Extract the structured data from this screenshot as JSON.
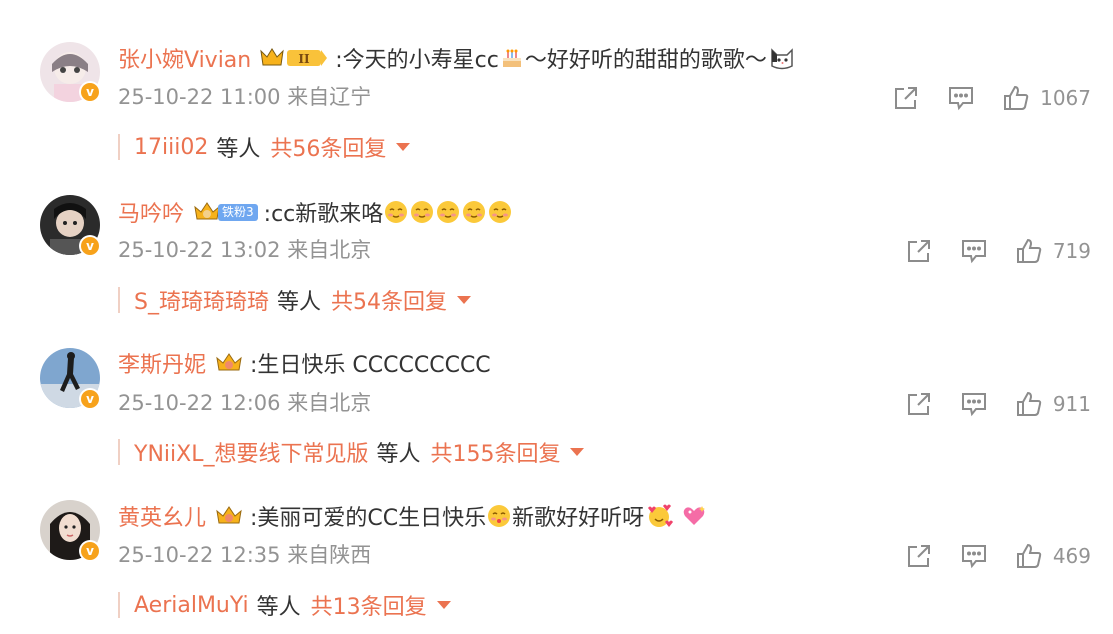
{
  "colors": {
    "accent": "#eb7350",
    "meta": "#939393",
    "text": "#333333",
    "vip": "#f7a21b"
  },
  "comments": [
    {
      "user": "张小婉Vivian",
      "badge_tag": "",
      "text_before": ":今天的小寿星cc",
      "text_after": "～好好听的甜甜的歌歌～",
      "time": "25-10-22 11:00",
      "location": "来自辽宁",
      "likes": "1067",
      "reply_user": "17iii02",
      "reply_mid": "等人",
      "reply_total": "共56条回复"
    },
    {
      "user": "马吟吟",
      "badge_tag": "铁粉3",
      "text_before": ":cc新歌来咯",
      "text_after": "",
      "time": "25-10-22 13:02",
      "location": "来自北京",
      "likes": "719",
      "reply_user": "S_琦琦琦琦琦",
      "reply_mid": "等人",
      "reply_total": "共54条回复"
    },
    {
      "user": "李斯丹妮",
      "badge_tag": "",
      "text_before": ":生日快乐 CCCCCCCCC",
      "text_after": "",
      "time": "25-10-22 12:06",
      "location": "来自北京",
      "likes": "911",
      "reply_user": "YNiiXL_想要线下常见版",
      "reply_mid": "等人",
      "reply_total": "共155条回复"
    },
    {
      "user": "黄英幺儿",
      "badge_tag": "",
      "text_before": ":美丽可爱的CC生日快乐",
      "text_mid": "新歌好好听呀",
      "text_after": "",
      "time": "25-10-22 12:35",
      "location": "来自陕西",
      "likes": "469",
      "reply_user": "AerialMuYi",
      "reply_mid": "等人",
      "reply_total": "共13条回复"
    }
  ]
}
